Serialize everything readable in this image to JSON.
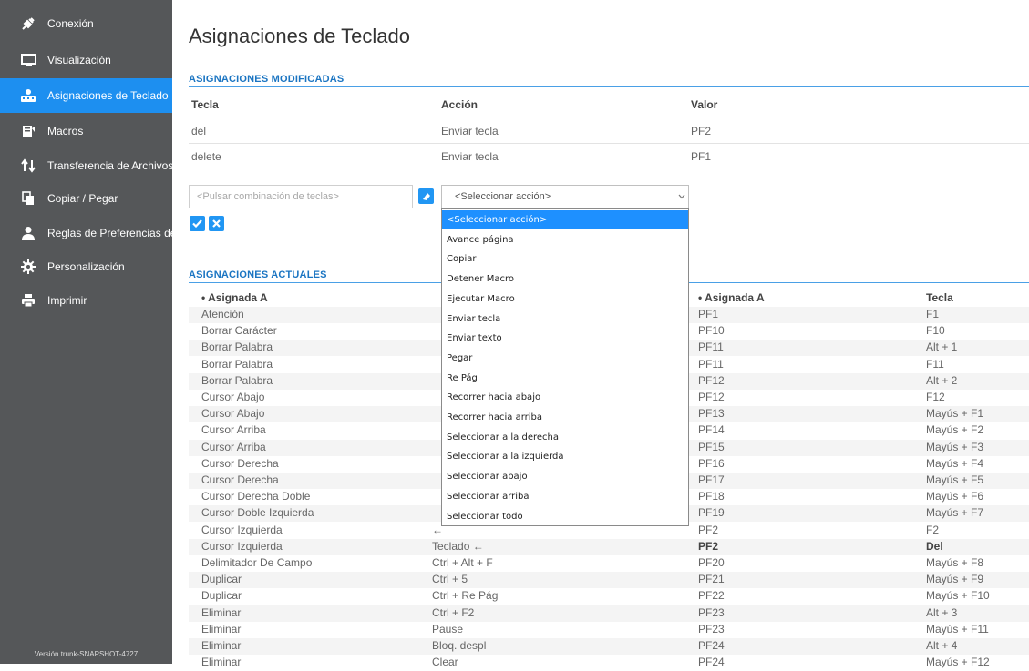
{
  "sidebar": {
    "items": [
      {
        "label": "Conexión",
        "icon": "plug-icon"
      },
      {
        "label": "Visualización",
        "icon": "monitor-icon"
      },
      {
        "label": "Asignaciones de Teclado",
        "icon": "keyboard-people-icon"
      },
      {
        "label": "Macros",
        "icon": "macro-icon"
      },
      {
        "label": "Transferencia de Archivos",
        "icon": "transfer-arrows-icon"
      },
      {
        "label": "Copiar / Pegar",
        "icon": "copy-icon"
      },
      {
        "label": "Reglas de Preferencias de...",
        "icon": "user-icon"
      },
      {
        "label": "Personalización",
        "icon": "gear-icon"
      },
      {
        "label": "Imprimir",
        "icon": "printer-icon"
      }
    ],
    "active_index": 2,
    "version": "Versión trunk-SNAPSHOT-4727"
  },
  "page": {
    "title": "Asignaciones de Teclado"
  },
  "modified": {
    "heading": "ASIGNACIONES MODIFICADAS",
    "columns": [
      "Tecla",
      "Acción",
      "Valor"
    ],
    "rows": [
      [
        "del",
        "Enviar tecla",
        "PF2"
      ],
      [
        "delete",
        "Enviar tecla",
        "PF1"
      ]
    ]
  },
  "editor": {
    "key_placeholder": "<Pulsar combinación de teclas>",
    "select_value": "<Seleccionar acción>",
    "options": [
      "<Seleccionar acción>",
      "Avance página",
      "Copiar",
      "Detener Macro",
      "Ejecutar Macro",
      "Enviar tecla",
      "Enviar texto",
      "Pegar",
      "Re Pág",
      "Recorrer hacia abajo",
      "Recorrer hacia arriba",
      "Seleccionar a la derecha",
      "Seleccionar a la izquierda",
      "Seleccionar abajo",
      "Seleccionar arriba",
      "Seleccionar todo"
    ],
    "selected_option_index": 0
  },
  "current": {
    "heading": "ASIGNACIONES ACTUALES",
    "left_header": "• Asignada A",
    "right_headers": [
      "• Asignada A",
      "Tecla"
    ],
    "left_rows": [
      [
        "Atención",
        ""
      ],
      [
        "Borrar Carácter",
        ""
      ],
      [
        "Borrar Palabra",
        ""
      ],
      [
        "Borrar Palabra",
        ""
      ],
      [
        "Borrar Palabra",
        ""
      ],
      [
        "Cursor Abajo",
        ""
      ],
      [
        "Cursor Abajo",
        ""
      ],
      [
        "Cursor Arriba",
        ""
      ],
      [
        "Cursor Arriba",
        ""
      ],
      [
        "Cursor Derecha",
        ""
      ],
      [
        "Cursor Derecha",
        ""
      ],
      [
        "Cursor Derecha Doble",
        ""
      ],
      [
        "Cursor Doble Izquierda",
        ""
      ],
      [
        "Cursor Izquierda",
        "←"
      ],
      [
        "Cursor Izquierda",
        "Teclado ←"
      ],
      [
        "Delimitador De Campo",
        "Ctrl + Alt + F"
      ],
      [
        "Duplicar",
        "Ctrl + 5"
      ],
      [
        "Duplicar",
        "Ctrl + Re Pág"
      ],
      [
        "Eliminar",
        "Ctrl + F2"
      ],
      [
        "Eliminar",
        "Pause"
      ],
      [
        "Eliminar",
        "Bloq. despl"
      ],
      [
        "Eliminar",
        "Clear"
      ]
    ],
    "right_rows": [
      [
        "PF1",
        "F1"
      ],
      [
        "PF10",
        "F10"
      ],
      [
        "PF11",
        "Alt + 1"
      ],
      [
        "PF11",
        "F11"
      ],
      [
        "PF12",
        "Alt + 2"
      ],
      [
        "PF12",
        "F12"
      ],
      [
        "PF13",
        "Mayús + F1"
      ],
      [
        "PF14",
        "Mayús + F2"
      ],
      [
        "PF15",
        "Mayús + F3"
      ],
      [
        "PF16",
        "Mayús + F4"
      ],
      [
        "PF17",
        "Mayús + F5"
      ],
      [
        "PF18",
        "Mayús + F6"
      ],
      [
        "PF19",
        "Mayús + F7"
      ],
      [
        "PF2",
        "F2"
      ],
      [
        "PF2",
        "Del"
      ],
      [
        "PF20",
        "Mayús + F8"
      ],
      [
        "PF21",
        "Mayús + F9"
      ],
      [
        "PF22",
        "Mayús + F10"
      ],
      [
        "PF23",
        "Alt + 3"
      ],
      [
        "PF23",
        "Mayús + F11"
      ],
      [
        "PF24",
        "Alt + 4"
      ],
      [
        "PF24",
        "Mayús + F12"
      ]
    ],
    "bold_right_row_index": 14
  },
  "colors": {
    "sidebar_bg": "#555759",
    "active_blue": "#1d8ff0",
    "heading_blue": "#1b75c2",
    "button_blue": "#2196f3"
  }
}
